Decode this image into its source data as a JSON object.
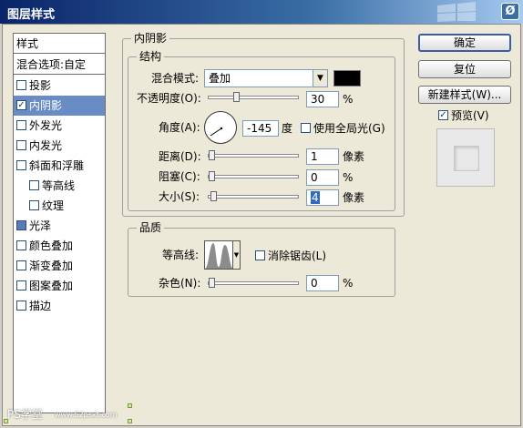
{
  "window": {
    "title": "图层样式",
    "close": "Ø"
  },
  "styles_list": {
    "header": "样式",
    "blend_options": "混合选项:自定",
    "items": [
      {
        "label": "投影",
        "checked": false
      },
      {
        "label": "内阴影",
        "checked": true
      },
      {
        "label": "外发光",
        "checked": false
      },
      {
        "label": "内发光",
        "checked": false
      },
      {
        "label": "斜面和浮雕",
        "checked": false
      },
      {
        "label": "等高线",
        "checked": false
      },
      {
        "label": "纹理",
        "checked": false
      },
      {
        "label": "光泽",
        "checked": true
      },
      {
        "label": "颜色叠加",
        "checked": false
      },
      {
        "label": "渐变叠加",
        "checked": false
      },
      {
        "label": "图案叠加",
        "checked": false
      },
      {
        "label": "描边",
        "checked": false
      }
    ]
  },
  "inner_shadow": {
    "section_title": "内阴影",
    "structure": {
      "title": "结构",
      "blend_mode_label": "混合模式:",
      "blend_mode_value": "叠加",
      "blend_color": "#000000",
      "opacity_label": "不透明度(O):",
      "opacity_value": "30",
      "opacity_unit": "%",
      "angle_label": "角度(A):",
      "angle_value": "-145",
      "angle_unit": "度",
      "global_light_label": "使用全局光(G)",
      "distance_label": "距离(D):",
      "distance_value": "1",
      "distance_unit": "像素",
      "choke_label": "阻塞(C):",
      "choke_value": "0",
      "choke_unit": "%",
      "size_label": "大小(S):",
      "size_value": "4",
      "size_unit": "像素"
    },
    "quality": {
      "title": "品质",
      "contour_label": "等高线:",
      "anti_alias_label": "消除锯齿(L)",
      "noise_label": "杂色(N):",
      "noise_value": "0",
      "noise_unit": "%"
    }
  },
  "buttons": {
    "ok": "确定",
    "reset": "复位",
    "new_style": "新建样式(W)...",
    "preview": "预览(V)"
  },
  "watermark": {
    "text": "PS学堂",
    "url": "www.52psxt.com"
  }
}
